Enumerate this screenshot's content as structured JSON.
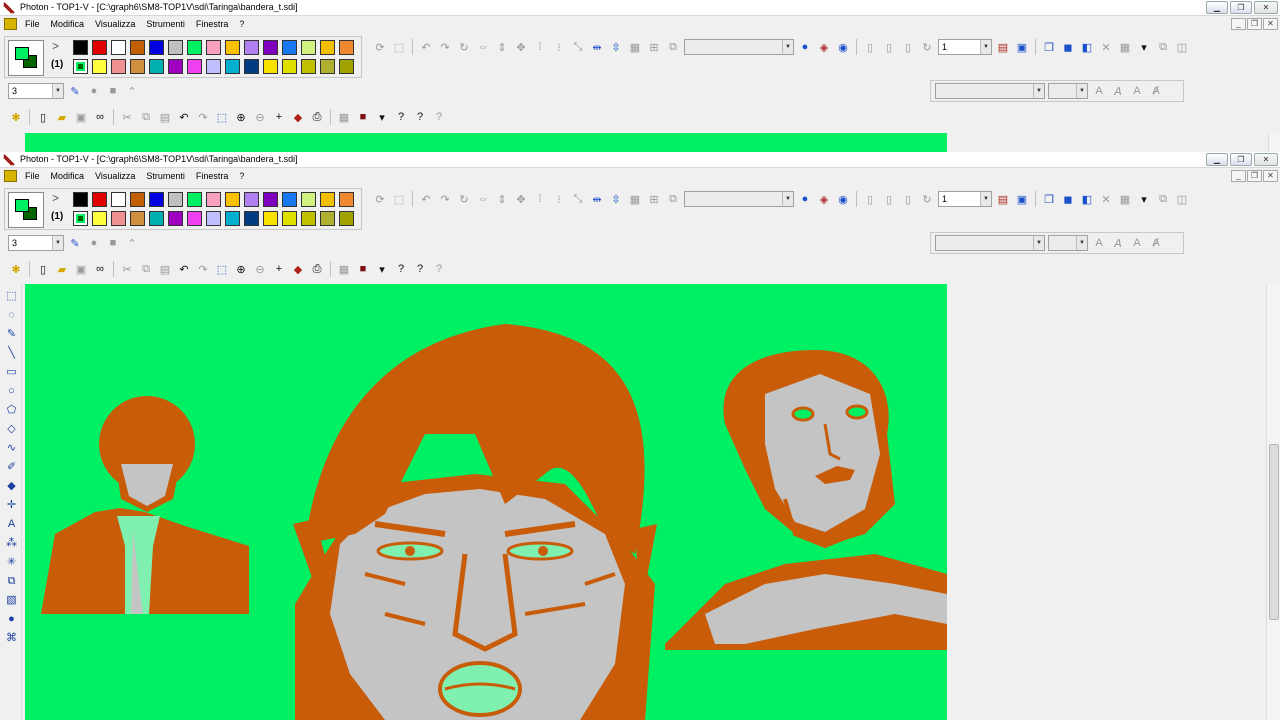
{
  "app": {
    "title": "Photon - TOP1-V - [C:\\graph6\\SM8-TOP1V\\sdi\\Taringa\\bandera_t.sdi]",
    "menu": [
      "File",
      "Modifica",
      "Visualizza",
      "Strumenti",
      "Finestra",
      "?"
    ],
    "window_buttons": {
      "minimize": "▁",
      "restore": "❐",
      "close": "✕"
    }
  },
  "palette": {
    "current_fg": "#00f064",
    "current_bg": "#006400",
    "count_label": "(1)",
    "arrow_label": ">",
    "colors": [
      "#000000",
      "#e00000",
      "#ffffff",
      "#c06000",
      "#0000e0",
      "#c0c0c0",
      "#00f064",
      "#f8a0c0",
      "#f8c000",
      "#b080f0",
      "#8000c0",
      "#1a78f0",
      "#d0f080",
      "#f0c000",
      "#f08830",
      "#006400",
      "#ffff40",
      "#f09090",
      "#d09040",
      "#00b0b0",
      "#a000c0",
      "#f040f0",
      "#c0c0ff",
      "#00b0d0",
      "#003a80",
      "#f8e000",
      "#e0e000",
      "#c0c000",
      "#b0b030",
      "#a0a000"
    ]
  },
  "toolbar": {
    "line_width": "3",
    "zoom_value": "1",
    "font_name": "",
    "font_size": ""
  },
  "colors": {
    "canvas_bg": "#00f064",
    "figure_orange": "#c85c08",
    "figure_gray": "#c4c4c4",
    "accent_light_green": "#80f0b0"
  },
  "icons": {
    "draw_tools": [
      "marquee-icon",
      "lasso-icon",
      "pencil-icon",
      "line-icon",
      "rectangle-icon",
      "ellipse-icon",
      "polygon-icon",
      "diamond-icon",
      "curve-icon",
      "brush-icon",
      "fill-icon",
      "crosshair-icon",
      "text-icon",
      "airbrush-icon",
      "sparkle-icon",
      "clone-icon",
      "gradient-icon",
      "blob-icon",
      "warp-icon"
    ]
  }
}
